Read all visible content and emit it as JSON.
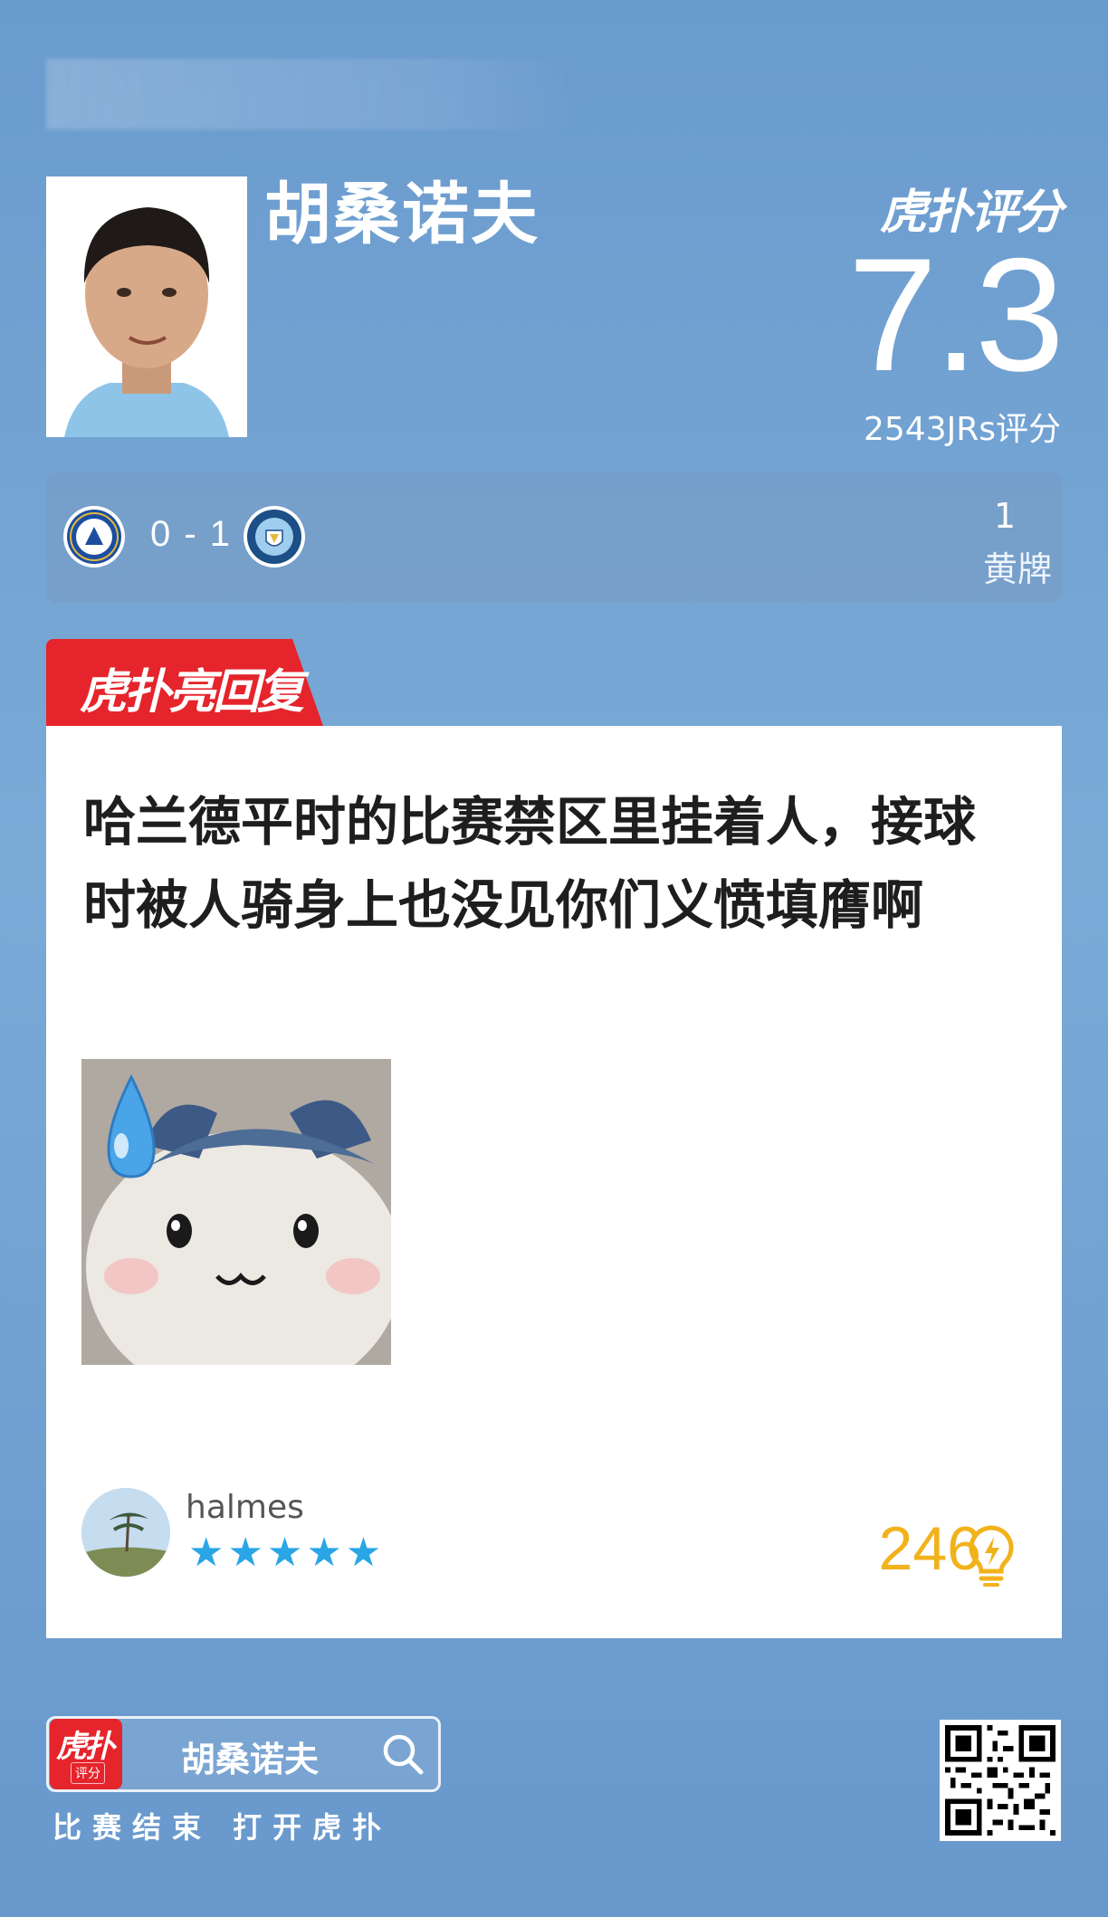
{
  "header": {
    "player_name": "胡桑诺夫",
    "brand": "虎扑评分",
    "score": "7.3",
    "rating_count": "2543JRs评分"
  },
  "match": {
    "home_team": "Chelsea",
    "away_team": "Manchester City",
    "score": "0 - 1",
    "card_count": "1",
    "card_label": "黄牌"
  },
  "ribbon": {
    "label": "虎扑亮回复"
  },
  "comment": {
    "text": "哈兰德平时的比赛禁区里挂着人，接球时被人骑身上也没见你们义愤填膺啊",
    "username": "halmes",
    "stars": "★★★★★",
    "star_count": 5,
    "light_count": "246"
  },
  "footer": {
    "app_icon_main": "虎扑",
    "app_icon_sub": "评分",
    "search_text": "胡桑诺夫",
    "tagline": "比赛结束 打开虎扑"
  },
  "colors": {
    "background": "#6a9bce",
    "ribbon": "#e5242b",
    "star": "#2aa6e6",
    "light": "#f2b21c"
  }
}
